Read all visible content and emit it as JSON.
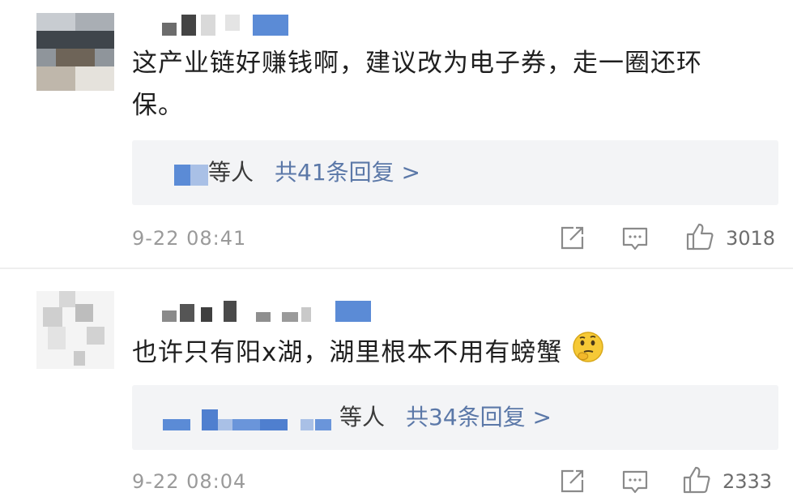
{
  "comments": [
    {
      "text_line1": "这产业链好赚钱啊，建议改为电子券，走一圈还环",
      "text_line2": "保。",
      "reply_people": "等人",
      "reply_count": "共41条回复 >",
      "time": "9-22 08:41",
      "likes": "3018"
    },
    {
      "text": "也许只有阳x湖，湖里根本不用有螃蟹",
      "emoji": "thinking-face",
      "reply_people": "等人",
      "reply_count": "共34条回复 >",
      "time": "9-22 08:04",
      "likes": "2333"
    }
  ],
  "colors": {
    "link": "#5b78a8",
    "reply_bg": "#f3f4f6",
    "meta": "#9a9a9a",
    "avatar_placeholder_blue": "#5b8bd6"
  },
  "icons": [
    "share-icon",
    "comment-icon",
    "like-thumb-icon"
  ]
}
